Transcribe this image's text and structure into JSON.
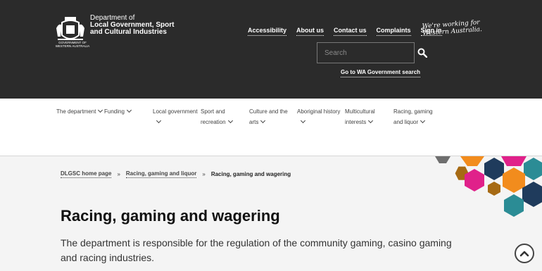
{
  "header": {
    "logo": {
      "line1": "Department of",
      "line2": "Local Government, Sport",
      "line3": "and Cultural Industries",
      "sub": "GOVERNMENT OF WESTERN AUSTRALIA"
    },
    "toplinks": [
      "Accessibility",
      "About us",
      "Contact us",
      "Complaints",
      "Sign in"
    ],
    "tagline_line1": "We're working for",
    "tagline_line2": "Western Australia.",
    "search_placeholder": "Search",
    "wa_link": "Go to WA Government search"
  },
  "nav": [
    {
      "line1": "The department",
      "line2": ""
    },
    {
      "line1": "Funding",
      "line2": ""
    },
    {
      "line1": "Local government",
      "line2": ""
    },
    {
      "line1": "Sport and",
      "line2": "recreation"
    },
    {
      "line1": "Culture and the",
      "line2": "arts"
    },
    {
      "line1": "Aboriginal history",
      "line2": ""
    },
    {
      "line1": "Multicultural",
      "line2": "interests"
    },
    {
      "line1": "Racing, gaming",
      "line2": "and liquor"
    }
  ],
  "breadcrumb": {
    "home": "DLGSC home page",
    "parent": "Racing, gaming and liquor",
    "current": "Racing, gaming and wagering",
    "sep": "»"
  },
  "page": {
    "title": "Racing, gaming and wagering",
    "intro": "The department is responsible for the regulation of the community gaming, casino gaming and racing industries."
  },
  "colors": {
    "header_bg": "#2b2b2b",
    "hex_orange": "#f28c1d",
    "hex_navy": "#1f3b5c",
    "hex_teal": "#2b8c95",
    "hex_pink": "#e0218a",
    "hex_brown": "#a66a14",
    "hex_grey": "#6e6e6e"
  }
}
